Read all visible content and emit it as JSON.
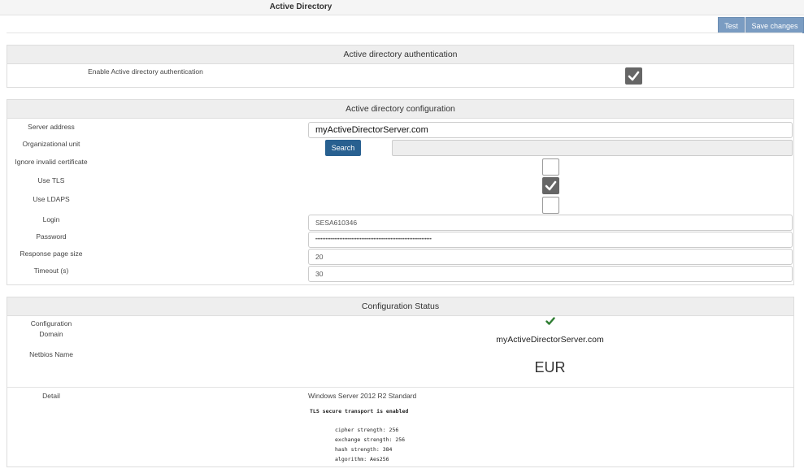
{
  "page": {
    "title": "Active Directory"
  },
  "toolbar": {
    "test_label": "Test",
    "save_label": "Save changes"
  },
  "auth": {
    "header": "Active directory authentication",
    "enable_label": "Enable Active directory authentication",
    "enable_checked": true
  },
  "config": {
    "header": "Active directory configuration",
    "server_address_label": "Server address",
    "server_address_value": "myActiveDirectorServer.com",
    "org_unit_label": "Organizational unit",
    "search_label": "Search",
    "org_unit_value": "",
    "ignore_cert_label": "Ignore invalid certificate",
    "ignore_cert_checked": false,
    "use_tls_label": "Use TLS",
    "use_tls_checked": true,
    "use_ldaps_label": "Use LDAPS",
    "use_ldaps_checked": false,
    "login_label": "Login",
    "login_value": "SESA610346",
    "password_label": "Password",
    "password_value": "••••••••••••••••••••••••••••••••••••••••••••••••••••••••••••••••••••",
    "page_size_label": "Response page size",
    "page_size_value": "20",
    "timeout_label": "Timeout (s)",
    "timeout_value": "30"
  },
  "status": {
    "header": "Configuration Status",
    "configuration_label": "Configuration",
    "configuration_icon": "check-icon",
    "configuration_color": "#2e7d32",
    "domain_label": "Domain",
    "domain_value": "myActiveDirectorServer.com",
    "netbios_label": "Netbios Name",
    "netbios_value": "EUR",
    "detail_label": "Detail",
    "detail_os": "Windows Server 2012 R2 Standard",
    "tls_line": "TLS secure transport is enabled",
    "cipher_line": "cipher strength: 256",
    "exchange_line": "exchange strength: 256",
    "hash_line": "hash strength: 384",
    "algorithm_line": "algorithm: Aes256"
  }
}
